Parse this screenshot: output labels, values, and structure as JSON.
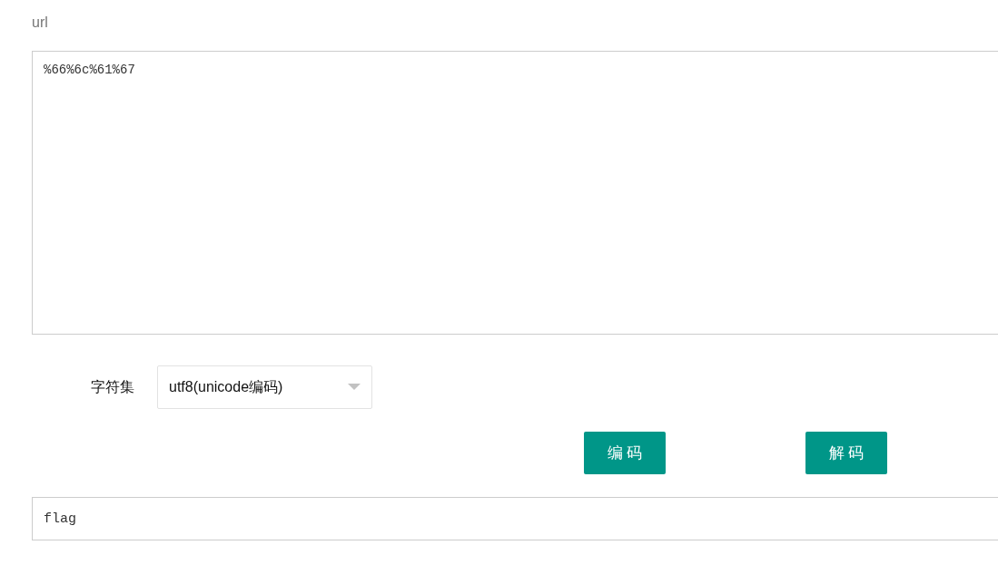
{
  "label": "url",
  "input_area": {
    "value": "%66%6c%61%67"
  },
  "charset": {
    "label": "字符集",
    "value": "utf8(unicode编码)"
  },
  "buttons": [
    {
      "label": "编 码"
    },
    {
      "label": "解 码"
    }
  ],
  "output": {
    "value": "flag"
  }
}
